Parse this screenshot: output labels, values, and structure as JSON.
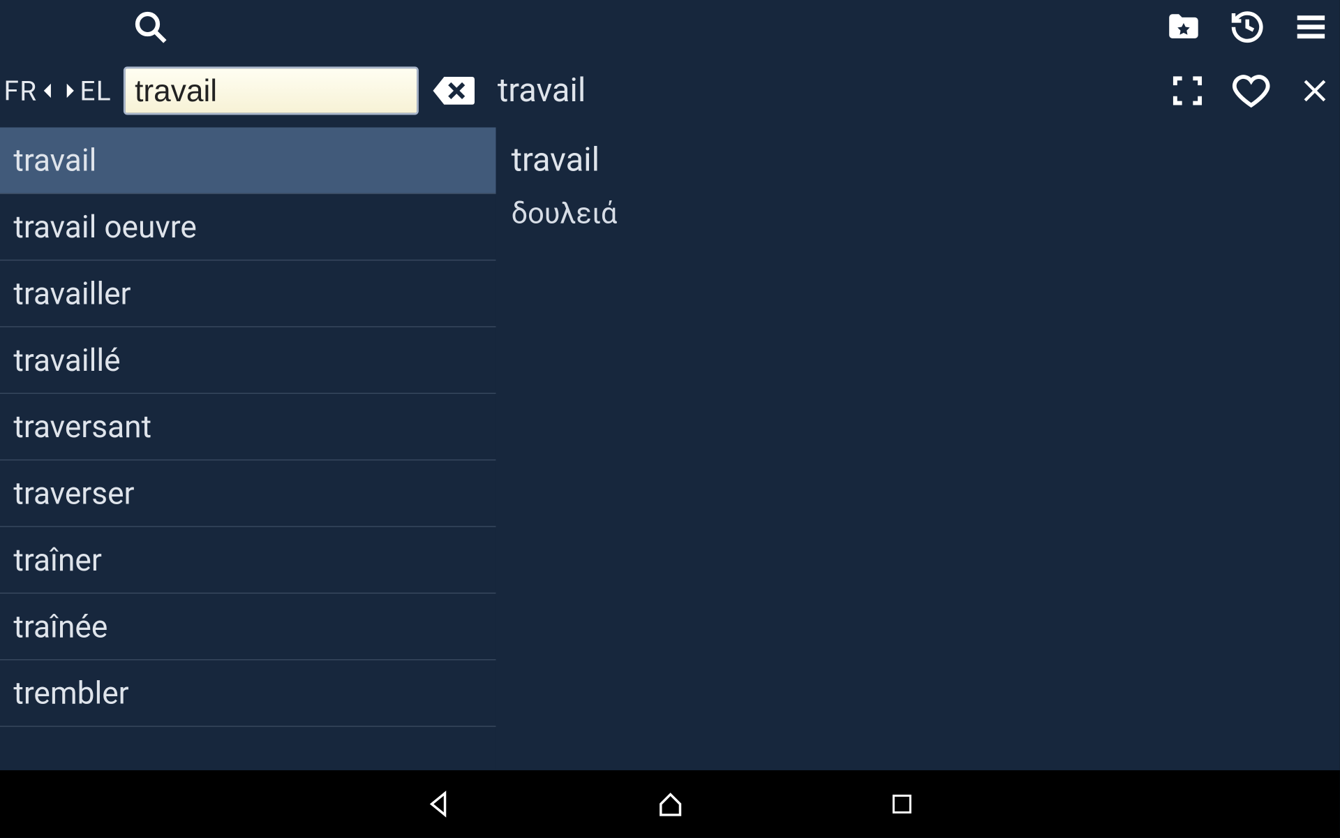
{
  "lang": {
    "from": "FR",
    "to": "EL"
  },
  "search": {
    "value": "travail"
  },
  "title_word": "travail",
  "result": {
    "headword": "travail",
    "translation": "δουλειά"
  },
  "suggestions": [
    "travail",
    "travail oeuvre",
    "travailler",
    "travaillé",
    "traversant",
    "traverser",
    "traîner",
    "traînée",
    "trembler"
  ],
  "selected_index": 0
}
